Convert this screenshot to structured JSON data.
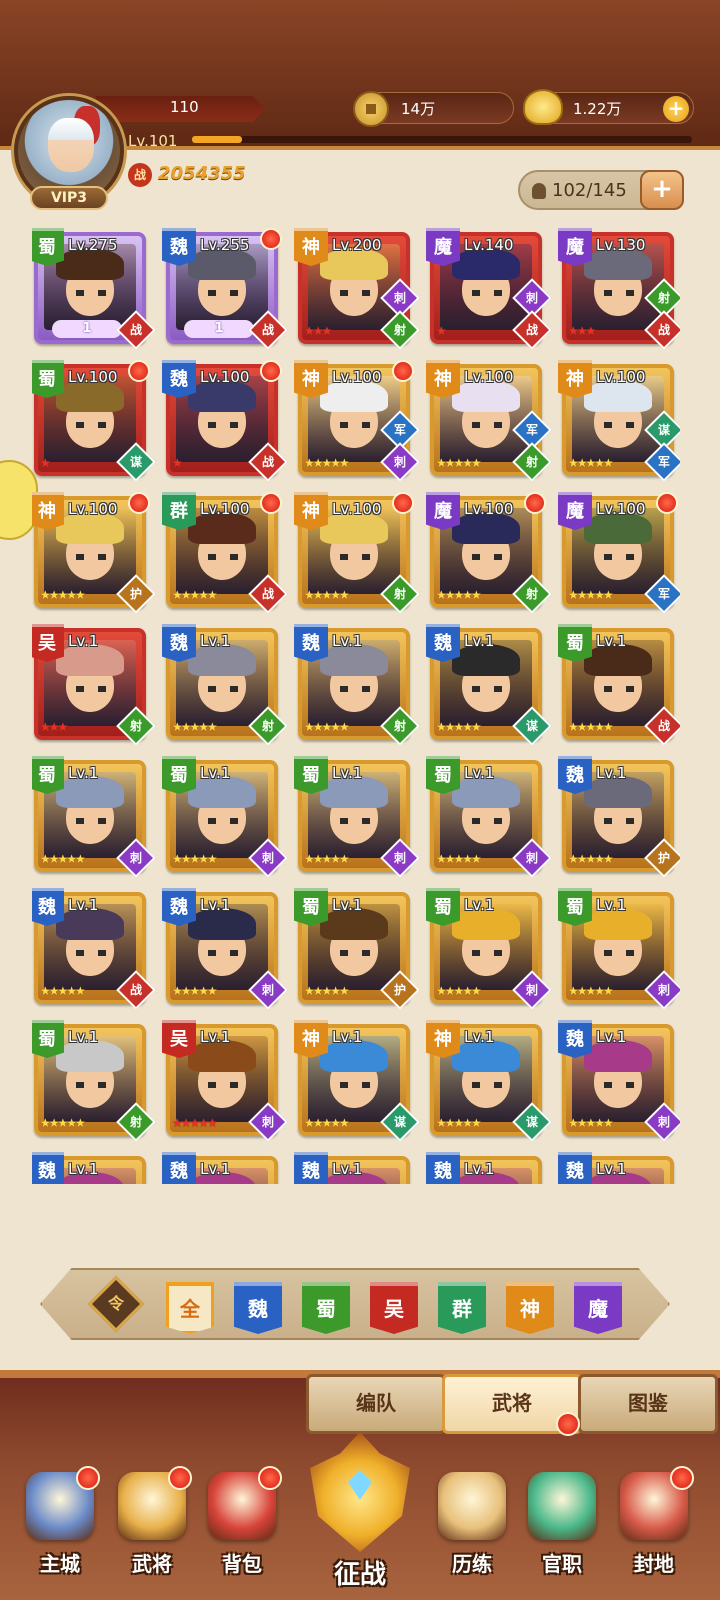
{
  "player": {
    "hp": "110",
    "level": "Lv.101",
    "exp_progress": 0.1,
    "vip": "VIP3",
    "power": "2054355",
    "power_icon_text": "战"
  },
  "resources": {
    "coins": "14万",
    "gold": "1.22万",
    "plus": "+"
  },
  "capacity": {
    "value": "102/145",
    "plus": "+"
  },
  "colors": {
    "蜀": "#3c9a2a",
    "魏": "#2a62c4",
    "吴": "#c42a22",
    "群": "#2a9a5a",
    "神": "#e08a1a",
    "魔": "#7a3ac4",
    "role_战": "#c8302a",
    "role_刺": "#8a3ac4",
    "role_射": "#3a9a2a",
    "role_军": "#2a72c4",
    "role_谋": "#2a9a6a",
    "role_护": "#b8741c"
  },
  "heroes": [
    {
      "faction": "蜀",
      "lv": "Lv.275",
      "frame": "purple",
      "stars": "",
      "star_style": "gold",
      "ribbon": "1",
      "role": "战",
      "dot": false,
      "hair": "#4a2a18"
    },
    {
      "faction": "魏",
      "lv": "Lv.255",
      "frame": "purple",
      "stars": "",
      "star_style": "gold",
      "ribbon": "1",
      "role": "战",
      "dot": true,
      "hair": "#5a5a6a"
    },
    {
      "faction": "神",
      "lv": "Lv.200",
      "frame": "red",
      "stars": "★★★",
      "star_style": "red",
      "ribbon": "",
      "role": "刺",
      "role2": "射",
      "dot": false,
      "hair": "#e8c85a"
    },
    {
      "faction": "魔",
      "lv": "Lv.140",
      "frame": "red",
      "stars": "★",
      "star_style": "red",
      "ribbon": "",
      "role": "刺",
      "role2": "战",
      "dot": false,
      "hair": "#2a2a6a"
    },
    {
      "faction": "魔",
      "lv": "Lv.130",
      "frame": "red",
      "stars": "★★★",
      "star_style": "red",
      "ribbon": "",
      "role": "射",
      "role2": "战",
      "dot": false,
      "hair": "#6a6a7a"
    },
    {
      "faction": "蜀",
      "lv": "Lv.100",
      "frame": "red",
      "stars": "★",
      "star_style": "red",
      "ribbon": "",
      "role": "谋",
      "dot": true,
      "hair": "#8a6a2a"
    },
    {
      "faction": "魏",
      "lv": "Lv.100",
      "frame": "red",
      "stars": "★",
      "star_style": "red",
      "ribbon": "",
      "role": "战",
      "dot": true,
      "hair": "#3a3a6a"
    },
    {
      "faction": "神",
      "lv": "Lv.100",
      "frame": "gold",
      "stars": "★★★★★",
      "star_style": "gold",
      "ribbon": "",
      "role": "军",
      "role2": "刺",
      "dot": true,
      "hair": "#eeeeee"
    },
    {
      "faction": "神",
      "lv": "Lv.100",
      "frame": "gold",
      "stars": "★★★★★",
      "star_style": "gold",
      "ribbon": "",
      "role": "军",
      "role2": "射",
      "dot": false,
      "hair": "#e8e0f0"
    },
    {
      "faction": "神",
      "lv": "Lv.100",
      "frame": "gold",
      "stars": "★★★★★",
      "star_style": "gold",
      "ribbon": "",
      "role": "谋",
      "role2": "军",
      "dot": false,
      "hair": "#dde6ee"
    },
    {
      "faction": "神",
      "lv": "Lv.100",
      "frame": "gold",
      "stars": "★★★★★",
      "star_style": "gold",
      "ribbon": "",
      "role": "护",
      "dot": true,
      "hair": "#e8c85a"
    },
    {
      "faction": "群",
      "lv": "Lv.100",
      "frame": "gold",
      "stars": "★★★★★",
      "star_style": "gold",
      "ribbon": "",
      "role": "战",
      "dot": true,
      "hair": "#5a2a1a"
    },
    {
      "faction": "神",
      "lv": "Lv.100",
      "frame": "gold",
      "stars": "★★★★★",
      "star_style": "gold",
      "ribbon": "",
      "role": "射",
      "dot": true,
      "hair": "#e8c85a"
    },
    {
      "faction": "魔",
      "lv": "Lv.100",
      "frame": "gold",
      "stars": "★★★★★",
      "star_style": "gold",
      "ribbon": "",
      "role": "射",
      "dot": true,
      "hair": "#2a2a5a"
    },
    {
      "faction": "魔",
      "lv": "Lv.100",
      "frame": "gold",
      "stars": "★★★★★",
      "star_style": "gold",
      "ribbon": "",
      "role": "军",
      "dot": true,
      "hair": "#4a6a3a"
    },
    {
      "faction": "吴",
      "lv": "Lv.1",
      "frame": "red",
      "stars": "★★★",
      "star_style": "red",
      "ribbon": "",
      "role": "射",
      "dot": false,
      "hair": "#d89a8a"
    },
    {
      "faction": "魏",
      "lv": "Lv.1",
      "frame": "gold",
      "stars": "★★★★★",
      "star_style": "gold",
      "ribbon": "",
      "role": "射",
      "dot": false,
      "hair": "#8a8a9a"
    },
    {
      "faction": "魏",
      "lv": "Lv.1",
      "frame": "gold",
      "stars": "★★★★★",
      "star_style": "gold",
      "ribbon": "",
      "role": "射",
      "dot": false,
      "hair": "#8a8a9a"
    },
    {
      "faction": "魏",
      "lv": "Lv.1",
      "frame": "gold",
      "stars": "★★★★★",
      "star_style": "gold",
      "ribbon": "",
      "role": "谋",
      "dot": false,
      "hair": "#2a2a2a"
    },
    {
      "faction": "蜀",
      "lv": "Lv.1",
      "frame": "gold",
      "stars": "★★★★★",
      "star_style": "gold",
      "ribbon": "",
      "role": "战",
      "dot": false,
      "hair": "#4a2a18"
    },
    {
      "faction": "蜀",
      "lv": "Lv.1",
      "frame": "gold",
      "stars": "★★★★★",
      "star_style": "gold",
      "ribbon": "",
      "role": "刺",
      "dot": false,
      "hair": "#8a9ab8"
    },
    {
      "faction": "蜀",
      "lv": "Lv.1",
      "frame": "gold",
      "stars": "★★★★★",
      "star_style": "gold",
      "ribbon": "",
      "role": "刺",
      "dot": false,
      "hair": "#8a9ab8"
    },
    {
      "faction": "蜀",
      "lv": "Lv.1",
      "frame": "gold",
      "stars": "★★★★★",
      "star_style": "gold",
      "ribbon": "",
      "role": "刺",
      "dot": false,
      "hair": "#8a9ab8"
    },
    {
      "faction": "蜀",
      "lv": "Lv.1",
      "frame": "gold",
      "stars": "★★★★★",
      "star_style": "gold",
      "ribbon": "",
      "role": "刺",
      "dot": false,
      "hair": "#8a9ab8"
    },
    {
      "faction": "魏",
      "lv": "Lv.1",
      "frame": "gold",
      "stars": "★★★★★",
      "star_style": "gold",
      "ribbon": "",
      "role": "护",
      "dot": false,
      "hair": "#6a6a7a"
    },
    {
      "faction": "魏",
      "lv": "Lv.1",
      "frame": "gold",
      "stars": "★★★★★",
      "star_style": "gold",
      "ribbon": "",
      "role": "战",
      "dot": false,
      "hair": "#4a3a5a"
    },
    {
      "faction": "魏",
      "lv": "Lv.1",
      "frame": "gold",
      "stars": "★★★★★",
      "star_style": "gold",
      "ribbon": "",
      "role": "刺",
      "dot": false,
      "hair": "#2a2a4a"
    },
    {
      "faction": "蜀",
      "lv": "Lv.1",
      "frame": "gold",
      "stars": "★★★★★",
      "star_style": "gold",
      "ribbon": "",
      "role": "护",
      "dot": false,
      "hair": "#5a3a1a"
    },
    {
      "faction": "蜀",
      "lv": "Lv.1",
      "frame": "gold",
      "stars": "★★★★★",
      "star_style": "gold",
      "ribbon": "",
      "role": "刺",
      "dot": false,
      "hair": "#e8b02a"
    },
    {
      "faction": "蜀",
      "lv": "Lv.1",
      "frame": "gold",
      "stars": "★★★★★",
      "star_style": "gold",
      "ribbon": "",
      "role": "刺",
      "dot": false,
      "hair": "#e8b02a"
    },
    {
      "faction": "蜀",
      "lv": "Lv.1",
      "frame": "gold",
      "stars": "★★★★★",
      "star_style": "gold",
      "ribbon": "",
      "role": "射",
      "dot": false,
      "hair": "#c8c8c8"
    },
    {
      "faction": "吴",
      "lv": "Lv.1",
      "frame": "gold",
      "stars": "★★★★★",
      "star_style": "red",
      "ribbon": "",
      "role": "刺",
      "dot": false,
      "hair": "#8a4a1a"
    },
    {
      "faction": "神",
      "lv": "Lv.1",
      "frame": "gold",
      "stars": "★★★★★",
      "star_style": "gold",
      "ribbon": "",
      "role": "谋",
      "dot": false,
      "hair": "#3a8ad8"
    },
    {
      "faction": "神",
      "lv": "Lv.1",
      "frame": "gold",
      "stars": "★★★★★",
      "star_style": "gold",
      "ribbon": "",
      "role": "谋",
      "dot": false,
      "hair": "#3a8ad8"
    },
    {
      "faction": "魏",
      "lv": "Lv.1",
      "frame": "gold",
      "stars": "★★★★★",
      "star_style": "gold",
      "ribbon": "",
      "role": "刺",
      "dot": false,
      "hair": "#a83a8a"
    },
    {
      "faction": "魏",
      "lv": "Lv.1",
      "frame": "gold",
      "stars": "",
      "star_style": "gold",
      "ribbon": "",
      "role": "",
      "dot": false,
      "hair": "#a83a8a"
    },
    {
      "faction": "魏",
      "lv": "Lv.1",
      "frame": "gold",
      "stars": "",
      "star_style": "gold",
      "ribbon": "",
      "role": "",
      "dot": false,
      "hair": "#a83a8a"
    },
    {
      "faction": "魏",
      "lv": "Lv.1",
      "frame": "gold",
      "stars": "",
      "star_style": "gold",
      "ribbon": "",
      "role": "",
      "dot": false,
      "hair": "#a83a8a"
    },
    {
      "faction": "魏",
      "lv": "Lv.1",
      "frame": "gold",
      "stars": "",
      "star_style": "gold",
      "ribbon": "",
      "role": "",
      "dot": false,
      "hair": "#a83a8a"
    },
    {
      "faction": "魏",
      "lv": "Lv.1",
      "frame": "gold",
      "stars": "",
      "star_style": "gold",
      "ribbon": "",
      "role": "",
      "dot": false,
      "hair": "#a83a8a"
    }
  ],
  "filter": {
    "sort_icon": "令",
    "items": [
      "全",
      "魏",
      "蜀",
      "吴",
      "群",
      "神",
      "魔"
    ]
  },
  "tabs": [
    "编队",
    "武将",
    "图鉴"
  ],
  "nav": {
    "items": [
      {
        "label": "主城",
        "icon": "castle-icon",
        "color": "#6a8ac8",
        "dot": true
      },
      {
        "label": "武将",
        "icon": "hero-helmet-icon",
        "color": "#e8b04a",
        "dot": true
      },
      {
        "label": "背包",
        "icon": "bag-icon",
        "color": "#d8443a",
        "dot": true
      },
      {
        "label": "历练",
        "icon": "scroll-icon",
        "color": "#e8c07a",
        "dot": false
      },
      {
        "label": "官职",
        "icon": "jade-seal-icon",
        "color": "#4ab88a",
        "dot": false
      },
      {
        "label": "封地",
        "icon": "palace-icon",
        "color": "#d85a4a",
        "dot": true
      }
    ],
    "battle_label": "征战"
  }
}
